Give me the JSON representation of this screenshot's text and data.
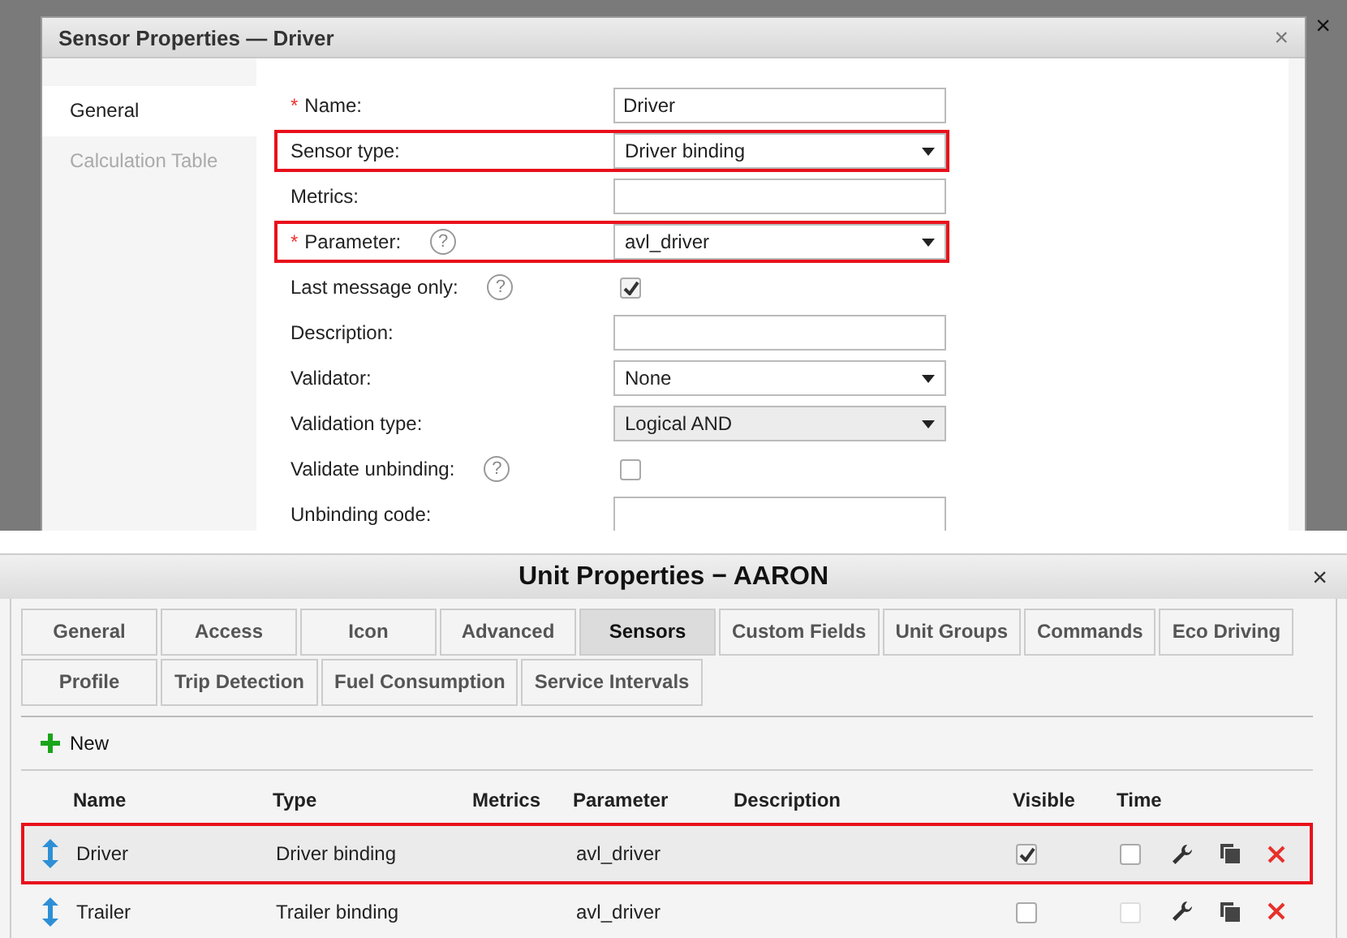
{
  "backdrop": {
    "close": "×"
  },
  "sensor_dialog": {
    "title": "Sensor Properties — Driver",
    "close": "×",
    "tabs": [
      {
        "label": "General",
        "selected": true
      },
      {
        "label": "Calculation Table",
        "selected": false
      }
    ],
    "fields": [
      {
        "kind": "text",
        "required": "*",
        "label": "Name:",
        "value": "Driver",
        "highlighted": false
      },
      {
        "kind": "select",
        "label": "Sensor type:",
        "value": "Driver binding",
        "highlighted": true,
        "disabled": false
      },
      {
        "kind": "text",
        "label": "Metrics:",
        "highlighted": false
      },
      {
        "kind": "select",
        "required": "*",
        "label": "Parameter:",
        "help": "?",
        "value": "avl_driver",
        "highlighted": true,
        "disabled": false
      },
      {
        "kind": "checkbox",
        "label": "Last message only:",
        "help": "?",
        "checked": true,
        "highlighted": false
      },
      {
        "kind": "text",
        "label": "Description:",
        "highlighted": false
      },
      {
        "kind": "select",
        "label": "Validator:",
        "value": "None",
        "highlighted": false,
        "disabled": false
      },
      {
        "kind": "select",
        "label": "Validation type:",
        "value": "Logical AND",
        "highlighted": false,
        "disabled": true
      },
      {
        "kind": "checkbox",
        "label": "Validate unbinding:",
        "help": "?",
        "checked": false,
        "highlighted": false
      },
      {
        "kind": "text",
        "label": "Unbinding code:",
        "highlighted": false
      }
    ]
  },
  "unit_window": {
    "title": "Unit Properties − AARON",
    "close": "×",
    "tab_rows": [
      [
        {
          "label": "General",
          "selected": false
        },
        {
          "label": "Access",
          "selected": false
        },
        {
          "label": "Icon",
          "selected": false
        },
        {
          "label": "Advanced",
          "selected": false
        },
        {
          "label": "Sensors",
          "selected": true
        },
        {
          "label": "Custom Fields",
          "selected": false
        },
        {
          "label": "Unit Groups",
          "selected": false
        },
        {
          "label": "Commands",
          "selected": false
        },
        {
          "label": "Eco Driving",
          "selected": false
        }
      ],
      [
        {
          "label": "Profile",
          "selected": false
        },
        {
          "label": "Trip Detection",
          "selected": false
        },
        {
          "label": "Fuel Consumption",
          "selected": false
        },
        {
          "label": "Service Intervals",
          "selected": false
        }
      ]
    ],
    "new_button": "New",
    "table": {
      "columns": [
        "Name",
        "Type",
        "Metrics",
        "Parameter",
        "Description",
        "Visible",
        "Time"
      ],
      "rows": [
        {
          "name": "Driver",
          "type": "Driver binding",
          "parameter": "avl_driver",
          "visible": true,
          "time": false,
          "time_disabled": false,
          "highlighted": true
        },
        {
          "name": "Trailer",
          "type": "Trailer binding",
          "parameter": "avl_driver",
          "visible": false,
          "time": false,
          "time_disabled": true,
          "highlighted": false
        }
      ]
    }
  }
}
